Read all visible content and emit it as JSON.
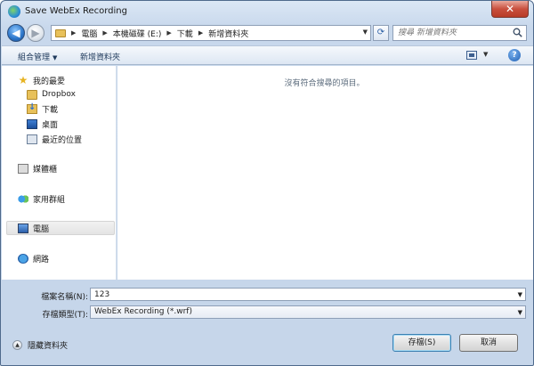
{
  "window": {
    "title": "Save WebEx Recording",
    "close_label": "✕"
  },
  "address": {
    "crumbs": [
      "電腦",
      "本機磁碟 (E:)",
      "下載",
      "新增資料夾"
    ]
  },
  "search": {
    "placeholder": "搜尋 新增資料夾"
  },
  "toolbar": {
    "organize": "組合管理",
    "new_folder": "新增資料夾",
    "help": "?"
  },
  "nav": {
    "favorites": "我的最愛",
    "dropbox": "Dropbox",
    "downloads": "下載",
    "desktop": "桌面",
    "recent": "最近的位置",
    "libraries": "媒體櫃",
    "homegroup": "家用群組",
    "computer": "電腦",
    "network": "網路"
  },
  "fileview": {
    "empty_message": "沒有符合搜尋的項目。"
  },
  "form": {
    "filename_label": "檔案名稱(N):",
    "filename_value": "123",
    "filetype_label": "存檔類型(T):",
    "filetype_value": "WebEx Recording (*.wrf)"
  },
  "footer": {
    "hide_folders": "隱藏資料夾",
    "save": "存檔(S)",
    "cancel": "取消"
  },
  "colors": {
    "accent": "#2a74c8",
    "frame": "#c6d6ea"
  }
}
